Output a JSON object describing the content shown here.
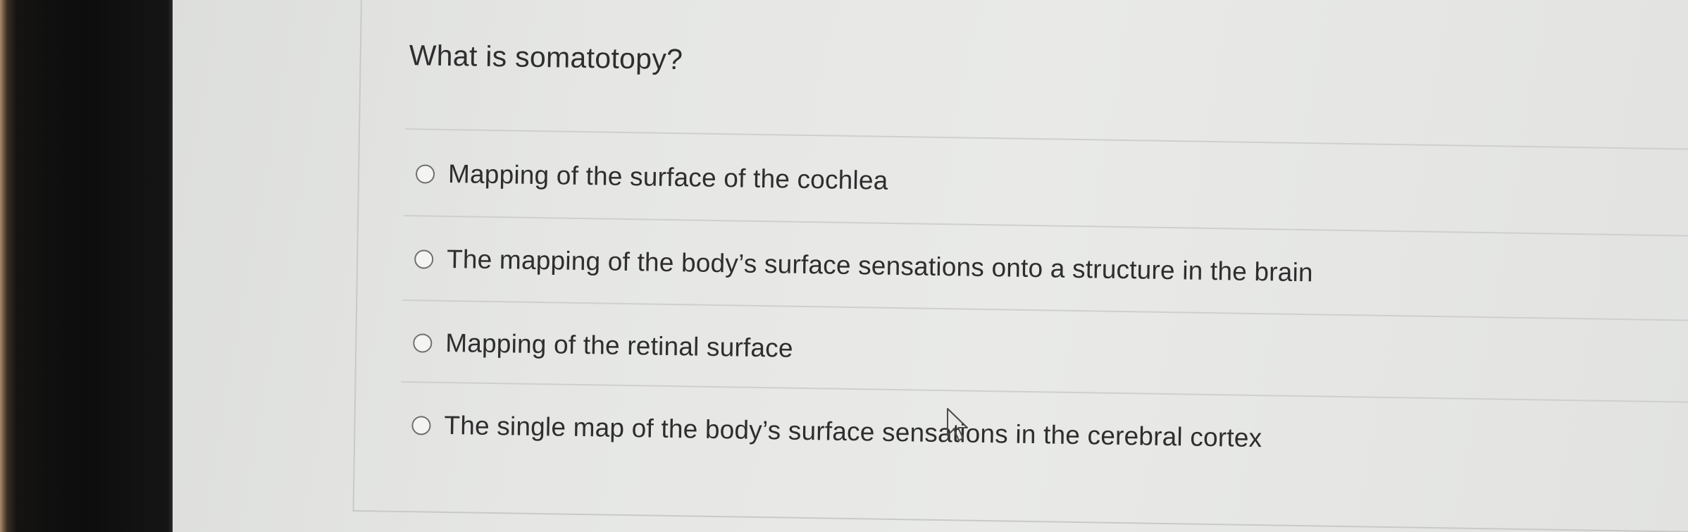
{
  "quiz": {
    "question": "What is somatotopy?",
    "options": [
      {
        "label": "Mapping of the surface of the cochlea",
        "selected": false
      },
      {
        "label": "The mapping of the body’s surface sensations onto a structure in the brain",
        "selected": false
      },
      {
        "label": "Mapping of the retinal surface",
        "selected": false
      },
      {
        "label": "The single map of the body’s surface sensations in the cerebral cortex",
        "selected": false
      }
    ]
  },
  "cursor": {
    "icon": "arrow-pointer-icon"
  },
  "colors": {
    "page_background": "#e6e7e5",
    "text": "#2e2e2e",
    "divider": "#cfd0ce",
    "radio_border": "#6f7070"
  }
}
